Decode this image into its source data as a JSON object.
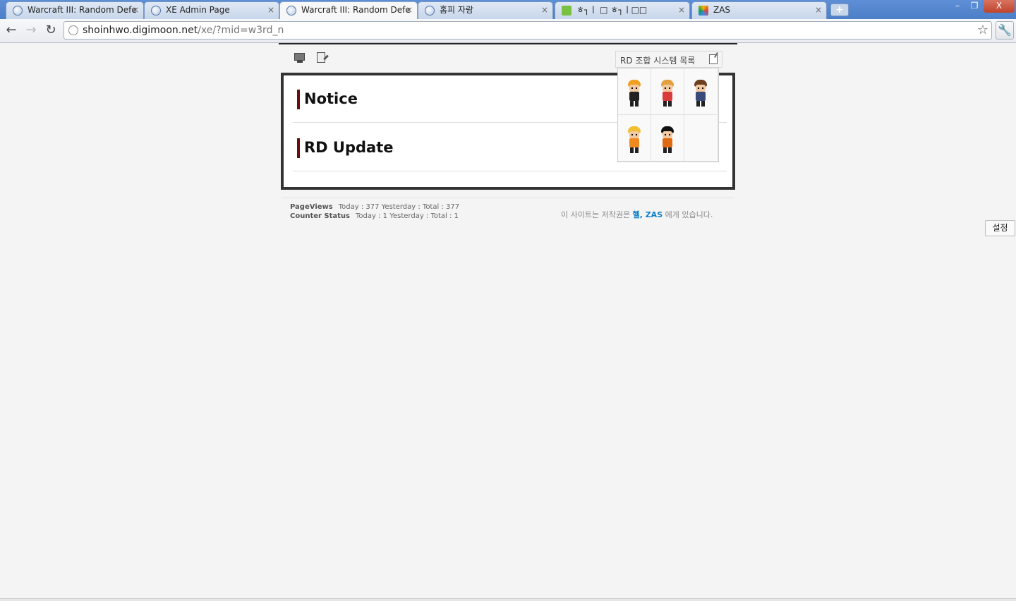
{
  "browser": {
    "tabs": [
      {
        "title": "Warcraft III: Random Defe",
        "close": "×",
        "active": false,
        "favicon": "globe-icon"
      },
      {
        "title": "XE Admin Page",
        "close": "×",
        "active": false,
        "favicon": "globe-icon"
      },
      {
        "title": "Warcraft III: Random Defe",
        "close": "×",
        "active": true,
        "favicon": "globe-icon"
      },
      {
        "title": "홈피 자랑",
        "close": "×",
        "active": false,
        "favicon": "globe-icon"
      },
      {
        "title": "ㅎ┐ㅣ □ ㅎ┐ㅣ□□",
        "close": "×",
        "active": false,
        "favicon": "site-icon"
      },
      {
        "title": "ZAS",
        "close": "×",
        "active": false,
        "favicon": "zas-icon"
      }
    ],
    "new_tab": "+",
    "window_buttons": {
      "minimize": "–",
      "restore": "❐",
      "close": "X"
    },
    "nav": {
      "back": "←",
      "forward": "→",
      "reload": "↻"
    },
    "url_host": "shoinhwo.digimoon.net",
    "url_path": "/xe/?mid=w3rd_n",
    "bookmark_star": "☆",
    "wrench": "🔧"
  },
  "page": {
    "boards": [
      {
        "title": "Notice"
      },
      {
        "title": "RD Update"
      }
    ],
    "rd_panel": {
      "title": "RD 조합 시스템 목록",
      "characters": [
        {
          "name": "character-1",
          "hair": "#f0a020",
          "body": "#222222"
        },
        {
          "name": "character-2",
          "hair": "#222222",
          "body": "#d93b3b"
        },
        {
          "name": "character-3",
          "hair": "#6b3f1f",
          "body": "#3a4a7a"
        },
        {
          "name": "character-4",
          "hair": "#f0c030",
          "body": "#f08a20"
        },
        {
          "name": "character-5",
          "hair": "#111111",
          "body": "#e06a10"
        }
      ]
    },
    "counter": {
      "pageviews_label": "PageViews",
      "pageviews": "Today : 377 Yesterday : Total : 377",
      "status_label": "Counter Status",
      "status": "Today : 1 Yesterday : Total : 1"
    },
    "copyright": {
      "prefix": "이 사이트는 저작권은",
      "owner": "헬, ZAS",
      "suffix": "에게 있습니다."
    },
    "settings_button": "설정"
  }
}
